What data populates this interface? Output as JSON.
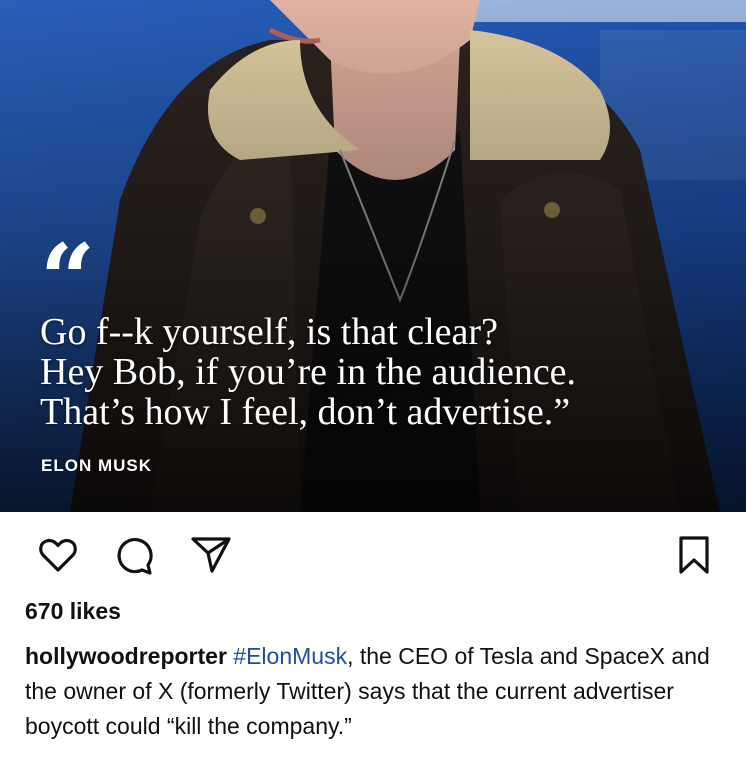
{
  "post": {
    "image": {
      "quote_mark": "“",
      "quote_lines": [
        "Go f--k yourself, is that clear?",
        "Hey Bob, if you’re in the audience.",
        "That’s how I feel, don’t advertise.”"
      ],
      "attribution": "ELON MUSK",
      "colors": {
        "background_blue": "#1e5bb0",
        "jacket": "#2a221d",
        "collar": "#d8c79c"
      }
    },
    "actions": {
      "like_icon": "heart-icon",
      "comment_icon": "comment-icon",
      "share_icon": "send-icon",
      "save_icon": "bookmark-icon"
    },
    "likes": "670 likes",
    "caption": {
      "username": "hollywoodreporter",
      "hashtag": "#ElonMusk",
      "text": ", the CEO of Tesla and SpaceX and the owner of X (formerly Twitter) says that the current advertiser boycott could “kill the company.”"
    }
  }
}
